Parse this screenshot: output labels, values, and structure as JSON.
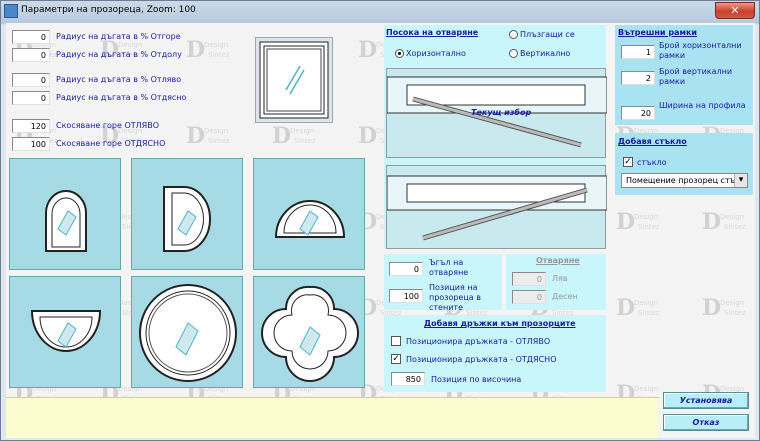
{
  "window": {
    "title": "Параметри на прозореца, Zoom:  100",
    "close": "✕"
  },
  "watermark": {
    "big": "D",
    "small": "Design",
    "small2": "Sintez"
  },
  "arc": {
    "rows": [
      {
        "value": "0",
        "label": "Радиус на дъгата в % Отгоре"
      },
      {
        "value": "0",
        "label": "Радиус на дъгата в % Отдолу"
      },
      {
        "value": "0",
        "label": "Радиус на дъгата в % Отляво"
      },
      {
        "value": "0",
        "label": "Радиус на дъгата в % Отдясно"
      }
    ]
  },
  "bevel": {
    "rows": [
      {
        "value": "120",
        "label": "Скосяване горе ОТЛЯВО"
      },
      {
        "value": "100",
        "label": "Скосяване горе ОТДЯСНО"
      }
    ]
  },
  "opening": {
    "title": "Посока на отваряне",
    "opt_sliding": "Плъзгащи се",
    "opt_horizontal": "Хоризонтално",
    "opt_vertical": "Вертикално",
    "current_choice": "Текущ избор"
  },
  "angle": {
    "value": "0",
    "label": "Ъгъл на отваряне"
  },
  "position": {
    "value": "100",
    "label": "Позиция на прозореца в стените"
  },
  "open_side": {
    "title": "Отваряне",
    "left_value": "0",
    "left_label": "Ляв",
    "right_value": "0",
    "right_label": "Десен"
  },
  "handles": {
    "title": "Добавя дръжки към прозорците",
    "left_label": "Позиционира дръжката - ОТЛЯВО",
    "right_label": "Позиционира дръжката - ОТДЯСНО",
    "right_checked": "✓",
    "height_value": "850",
    "height_label": "Позиция по височина"
  },
  "inner": {
    "title": "Вътрешни рамки",
    "h_value": "1",
    "h_label": "Брой хоризонтални рамки",
    "v_value": "2",
    "v_label": "Брой вертикални рамки",
    "w_value": "20",
    "w_label": "Ширина на профила"
  },
  "glass": {
    "title": "Добавя стъкло",
    "check_label": "стъкло",
    "check_mark": "✓",
    "dropdown_value": "Помещение прозорец стъ",
    "dropdown_arrow": "▾"
  },
  "buttons": {
    "ok": "Установява",
    "cancel": "Отказ"
  },
  "colors": {
    "panel": "#a9e3f1",
    "panel_light": "#c8f6fb",
    "accent_text": "#1a1aa0",
    "status": "#fdfbd0"
  }
}
